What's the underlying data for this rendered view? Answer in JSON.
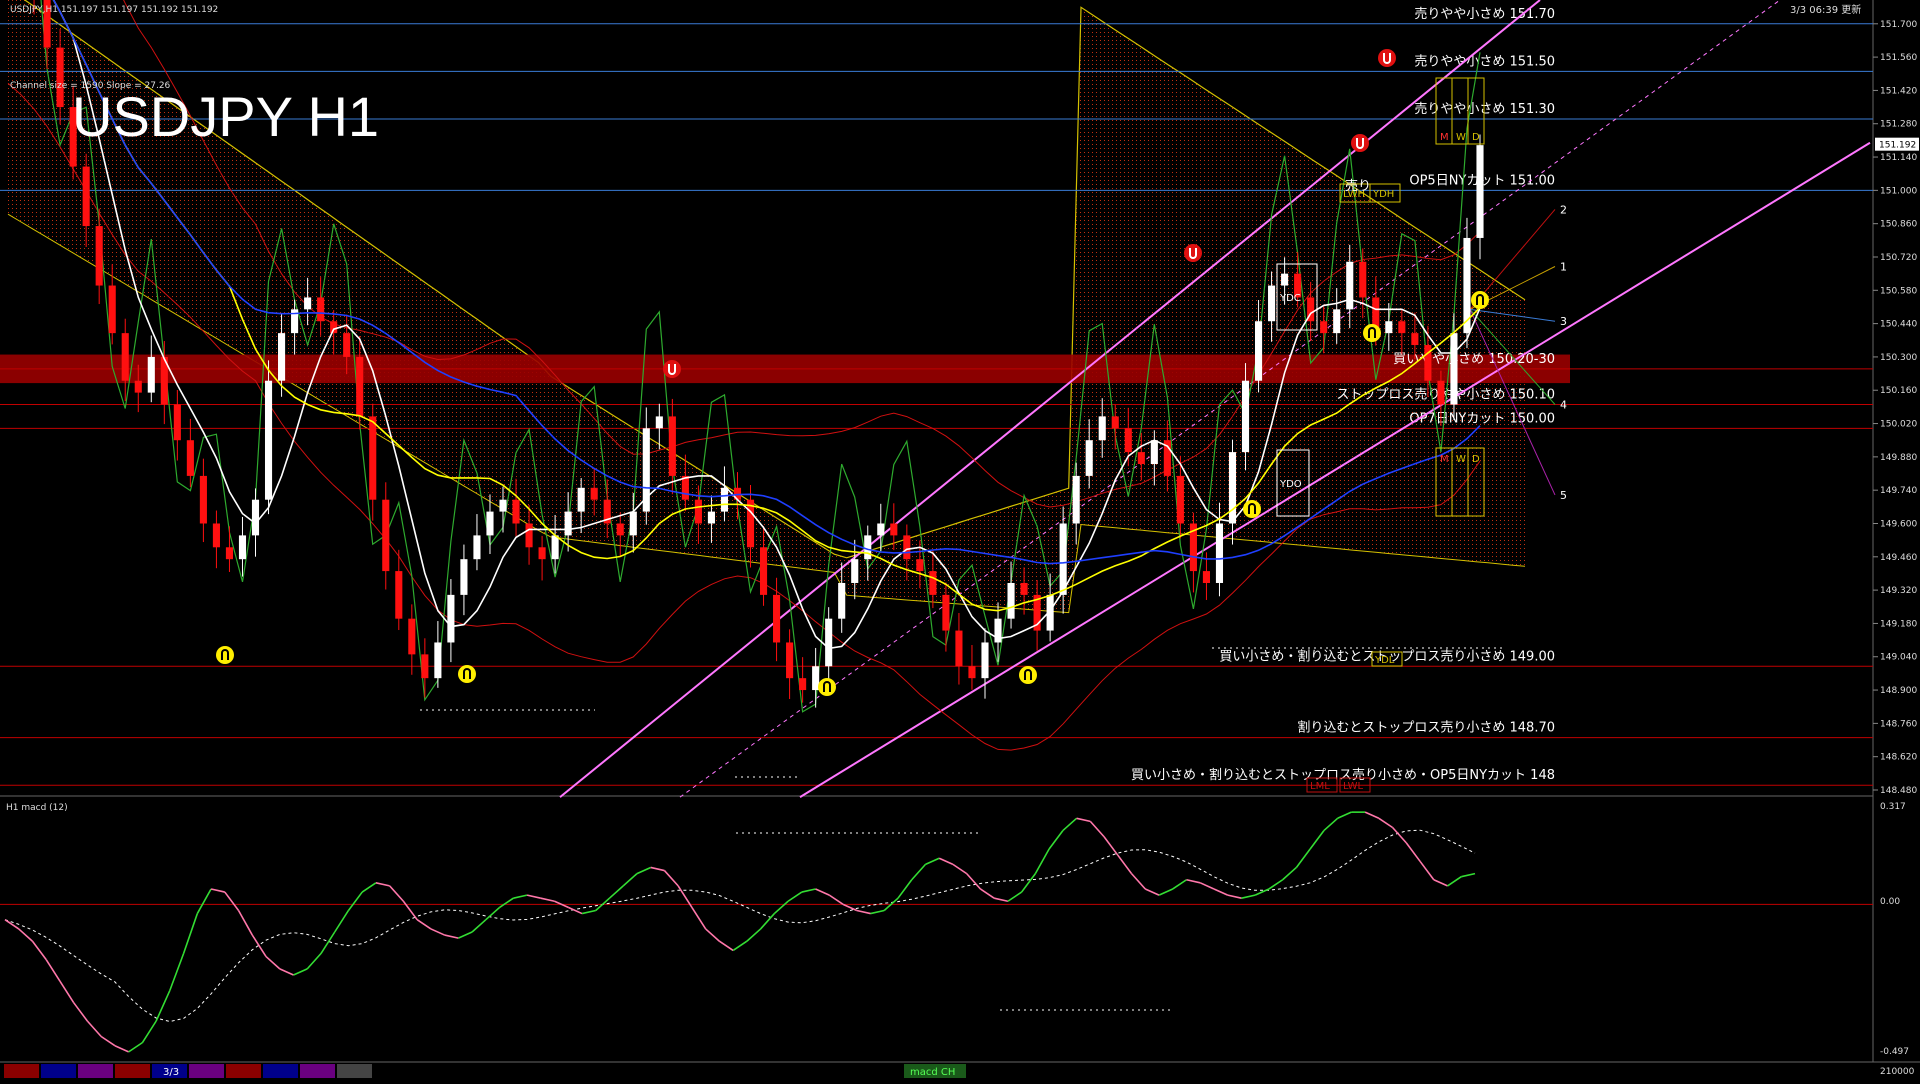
{
  "header": {
    "symbol_line": "USDJPY,H1  151.197 151.197 151.192 151.192",
    "channel_info": "Channel size = 1590 Slope = 27.26",
    "big_title": "USDJPY H1",
    "server_time": "3/3 06:39 更新"
  },
  "price_axis": {
    "ticks": [
      "151.700",
      "151.560",
      "151.420",
      "151.280",
      "151.140",
      "151.000",
      "150.860",
      "150.720",
      "150.580",
      "150.440",
      "150.300",
      "150.160",
      "150.020",
      "149.880",
      "149.740",
      "149.600",
      "149.460",
      "149.320",
      "149.180",
      "149.040",
      "148.900",
      "148.760",
      "148.620",
      "148.480"
    ],
    "current_price": "151.192"
  },
  "levels": [
    {
      "price": 151.7,
      "label": "売りやや小さめ 151.70",
      "color": "#3a7bd5"
    },
    {
      "price": 151.5,
      "label": "売りやや小さめ 151.50",
      "color": "#3a7bd5"
    },
    {
      "price": 151.3,
      "label": "売りやや小さめ 151.30",
      "color": "#3a7bd5"
    },
    {
      "price": 151.0,
      "label": "OP5日NYカット 151.00",
      "color": "#3a7bd5"
    },
    {
      "price": 150.25,
      "label": "買いやや小さめ 150.20-30",
      "color": "#c00000"
    },
    {
      "price": 150.1,
      "label": "ストップロス売りやや小さめ 150.10",
      "color": "#c00000"
    },
    {
      "price": 150.0,
      "label": "OP7日NYカット 150.00",
      "color": "#c00000"
    },
    {
      "price": 149.0,
      "label": "買い小さめ・割り込むとストップロス売り小さめ 149.00",
      "color": "#c00000"
    },
    {
      "price": 148.7,
      "label": "割り込むとストップロス売り小さめ 148.70",
      "color": "#c00000"
    },
    {
      "price": 148.5,
      "label": "買い小さめ・割り込むとストップロス売り小さめ・OP5日NYカット 148",
      "color": "#c00000"
    }
  ],
  "markers": {
    "sell_label": "売り",
    "ydc": "YDC",
    "ydo": "YDO",
    "ydl": "YDL",
    "lwh": "LWH",
    "ydh": "YDH",
    "lml": "LML",
    "lwl": "LWL",
    "mwd_top": [
      "M",
      "W",
      "D"
    ],
    "mwd_mid": [
      "M",
      "W",
      "D"
    ],
    "projection_numbers": [
      "1",
      "2",
      "3",
      "4",
      "5"
    ]
  },
  "macd_panel": {
    "label": "H1  macd (12)",
    "ticks": [
      "0.317",
      "0.00",
      "-0.497"
    ],
    "bottom_tick": "210000"
  },
  "bottom_bar": {
    "date_label": "3/3",
    "tab_label": "macd CH",
    "swatch_colors": [
      "#8b0000",
      "#00008b",
      "#6a0080",
      "#8b0000",
      "#00008b",
      "#6a0080",
      "#8b0000",
      "#00008b",
      "#6a0080",
      "#444444"
    ]
  },
  "chart_data": {
    "type": "line",
    "title": "USDJPY H1",
    "ylim": [
      148.48,
      151.8
    ],
    "close": [
      152.05,
      151.95,
      151.8,
      151.6,
      151.35,
      151.1,
      150.85,
      150.6,
      150.4,
      150.2,
      150.15,
      150.3,
      150.1,
      149.95,
      149.8,
      149.6,
      149.5,
      149.45,
      149.55,
      149.7,
      150.2,
      150.4,
      150.5,
      150.55,
      150.45,
      150.4,
      150.3,
      150.05,
      149.7,
      149.4,
      149.2,
      149.05,
      148.95,
      149.1,
      149.3,
      149.45,
      149.55,
      149.65,
      149.7,
      149.6,
      149.5,
      149.45,
      149.55,
      149.65,
      149.75,
      149.7,
      149.6,
      149.55,
      149.65,
      150.0,
      150.05,
      149.8,
      149.7,
      149.6,
      149.65,
      149.75,
      149.7,
      149.5,
      149.3,
      149.1,
      148.95,
      148.9,
      149.0,
      149.2,
      149.35,
      149.45,
      149.55,
      149.6,
      149.55,
      149.45,
      149.4,
      149.3,
      149.15,
      149.0,
      148.95,
      149.1,
      149.2,
      149.35,
      149.3,
      149.15,
      149.3,
      149.6,
      149.8,
      149.95,
      150.05,
      150.0,
      149.9,
      149.85,
      149.95,
      149.8,
      149.6,
      149.4,
      149.35,
      149.6,
      149.9,
      150.2,
      150.45,
      150.6,
      150.65,
      150.55,
      150.45,
      150.4,
      150.5,
      150.7,
      150.55,
      150.4,
      150.45,
      150.4,
      150.35,
      150.2,
      150.1,
      150.4,
      150.8,
      151.19
    ],
    "macd": [
      -0.05,
      -0.08,
      -0.12,
      -0.18,
      -0.25,
      -0.32,
      -0.38,
      -0.43,
      -0.46,
      -0.48,
      -0.45,
      -0.38,
      -0.28,
      -0.16,
      -0.03,
      0.05,
      0.04,
      -0.02,
      -0.1,
      -0.17,
      -0.21,
      -0.23,
      -0.21,
      -0.16,
      -0.09,
      -0.02,
      0.04,
      0.07,
      0.06,
      0.01,
      -0.05,
      -0.08,
      -0.1,
      -0.11,
      -0.09,
      -0.05,
      -0.01,
      0.02,
      0.03,
      0.02,
      0.01,
      -0.01,
      -0.03,
      -0.02,
      0.02,
      0.06,
      0.1,
      0.12,
      0.11,
      0.06,
      -0.01,
      -0.08,
      -0.12,
      -0.15,
      -0.12,
      -0.08,
      -0.03,
      0.01,
      0.04,
      0.05,
      0.03,
      0.0,
      -0.02,
      -0.03,
      -0.02,
      0.02,
      0.08,
      0.13,
      0.15,
      0.13,
      0.1,
      0.05,
      0.02,
      0.01,
      0.04,
      0.1,
      0.18,
      0.24,
      0.28,
      0.27,
      0.22,
      0.16,
      0.1,
      0.05,
      0.03,
      0.05,
      0.08,
      0.07,
      0.05,
      0.03,
      0.02,
      0.03,
      0.05,
      0.08,
      0.12,
      0.18,
      0.24,
      0.28,
      0.3,
      0.3,
      0.28,
      0.25,
      0.2,
      0.14,
      0.08,
      0.06,
      0.09,
      0.1
    ],
    "macd_ylim": [
      -0.5,
      0.32
    ]
  },
  "colors": {
    "white_ma": "#ffffff",
    "yellow_ma": "#ffff00",
    "blue_ma": "#1f3fff",
    "chikou": "#2eaa2e",
    "bollinger": "#d01010",
    "channel": "#ff77ff",
    "kumo": "#c03010",
    "macd": "#33dd33",
    "macd_neg": "#ff77aa",
    "signal": "#ffffff"
  }
}
